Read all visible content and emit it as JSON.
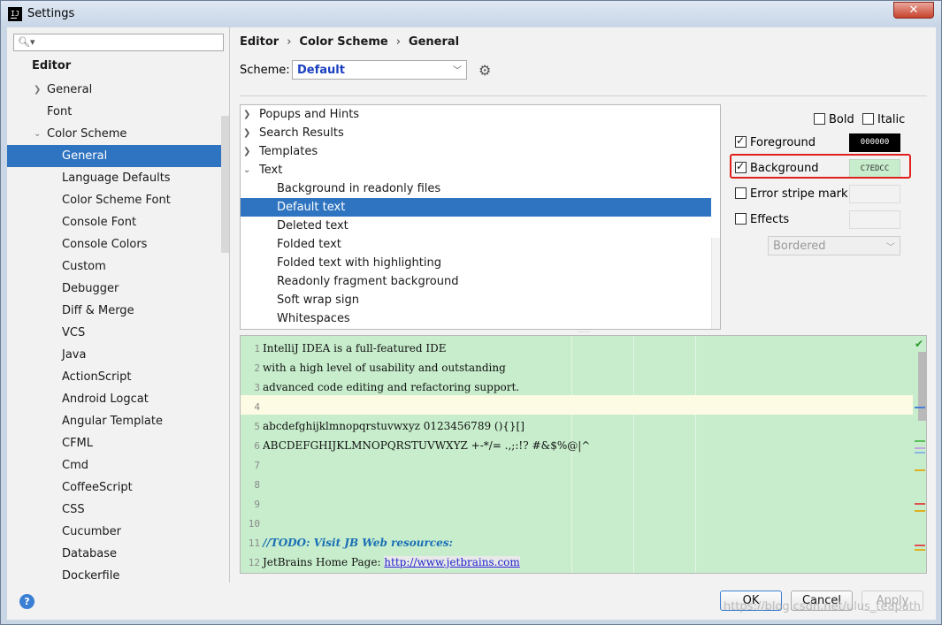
{
  "window": {
    "title": "Settings",
    "close_glyph": "✕",
    "app_icon": "IJ"
  },
  "search": {
    "placeholder": "",
    "icon": "search-icon"
  },
  "sidebar": {
    "heading": "Editor",
    "items": [
      "General",
      "Font",
      "Color Scheme",
      "General",
      "Language Defaults",
      "Color Scheme Font",
      "Console Font",
      "Console Colors",
      "Custom",
      "Debugger",
      "Diff & Merge",
      "VCS",
      "Java",
      "ActionScript",
      "Android Logcat",
      "Angular Template",
      "CFML",
      "Cmd",
      "CoffeeScript",
      "CSS",
      "Cucumber",
      "Database",
      "Dockerfile"
    ],
    "selected_index": 3
  },
  "breadcrumb": {
    "part1": "Editor",
    "part2": "Color Scheme",
    "part3": "General",
    "sep": "›"
  },
  "scheme": {
    "label": "Scheme:",
    "value": "Default"
  },
  "tree": {
    "items": [
      "Popups and Hints",
      "Search Results",
      "Templates",
      "Text",
      "Background in readonly files",
      "Default text",
      "Deleted text",
      "Folded text",
      "Folded text with highlighting",
      "Readonly fragment background",
      "Soft wrap sign",
      "Whitespaces"
    ],
    "selected_index": 5
  },
  "attributes": {
    "bold": "Bold",
    "italic": "Italic",
    "foreground": "Foreground",
    "foreground_value": "000000",
    "background": "Background",
    "background_value": "C7EDCC",
    "error_stripe": "Error stripe mark",
    "effects": "Effects",
    "effects_style": "Bordered"
  },
  "preview": {
    "line_numbers": [
      "1",
      "2",
      "3",
      "4",
      "5",
      "6",
      "7",
      "8",
      "9",
      "10",
      "11",
      "12"
    ],
    "lines": [
      "IntelliJ IDEA is a full-featured IDE",
      "with a high level of usability and outstanding",
      "advanced code editing and refactoring support.",
      "",
      "abcdefghijklmnopqrstuvwxyz 0123456789 (){}[]",
      "ABCDEFGHIJKLMNOPQRSTUVWXYZ +-*/= .,;:!? #&$%@|^",
      "",
      "",
      "",
      "",
      "//TODO: Visit JB Web resources:",
      "JetBrains Home Page: "
    ],
    "link": "http://www.jetbrains.com"
  },
  "buttons": {
    "ok": "OK",
    "cancel": "Cancel",
    "apply": "Apply",
    "help": "?"
  },
  "watermark": "https://blog.csdn.net/ulus_teapath",
  "colors": {
    "selection": "#2f74c0",
    "preview_bg": "#c7edcc",
    "highlight_border": "#e0201c",
    "scheme_text": "#1a3fbf"
  }
}
